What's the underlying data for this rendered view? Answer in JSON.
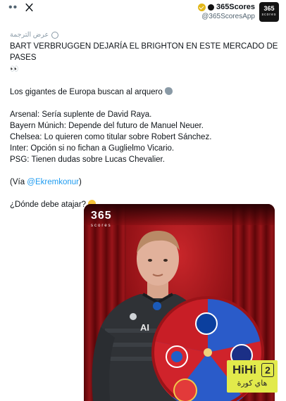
{
  "header": {
    "menu_dots": "••",
    "account_name": "365Scores",
    "account_handle": "@365ScoresApp",
    "avatar_line1": "365",
    "avatar_line2": "scores"
  },
  "translate_label": "عرض الترجمة",
  "tweet": {
    "headline": "BART VERBRUGGEN DEJARÍA EL BRIGHTON EN ESTE MERCADO DE PASES",
    "headline_emoji": "👀",
    "intro": "Los gigantes de Europa buscan al arquero",
    "clubs": [
      "Arsenal: Sería suplente de David Raya.",
      "Bayern Múnich: Depende del futuro de Manuel Neuer.",
      "Chelsea: Lo quieren como titular sobre Robert Sánchez.",
      "Inter: Opción si no fichan a Guglielmo Vicario.",
      "PSG: Tienen dudas sobre Lucas Chevalier."
    ],
    "via_prefix": "(Vía ",
    "via_mention": "@Ekremkonur",
    "via_suffix": ")",
    "question": "¿Dónde debe atajar?"
  },
  "media": {
    "logo_line1": "365",
    "logo_line2": "scores",
    "shirt_text": "AI"
  },
  "watermark": {
    "brand": "HiHi",
    "digit": "2",
    "arabic": "هاي كورة"
  },
  "colors": {
    "link": "#1d9bf0",
    "curtain_red": "#b0161c",
    "wheel_blue": "#2a5bc9",
    "wheel_red": "#d0232b",
    "watermark_yellow": "#e2ea4b"
  },
  "icons": [
    "menu-dots-icon",
    "x-logo-icon",
    "verified-badge-icon",
    "globe-icon",
    "gloves-emoji",
    "thinking-emoji"
  ]
}
